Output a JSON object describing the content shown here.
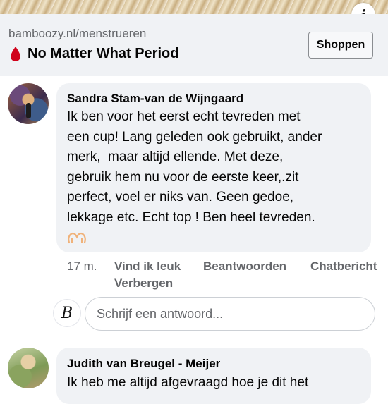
{
  "ad": {
    "url": "bamboozy.nl/menstrueren",
    "title": "No Matter What Period",
    "cta_label": "Shoppen",
    "info_label": "i"
  },
  "comments": [
    {
      "author": "Sandra Stam-van de Wijngaard",
      "lines": [
        "Ik ben voor het eerst echt tevreden met",
        "een cup! Lang geleden ook gebruikt, ander",
        "merk,  maar altijd ellende. Met deze,",
        "gebruik hem nu voor de eerste keer,.zit",
        "perfect, voel er niks van. Geen gedoe,",
        "lekkage etc. Echt top ! Ben heel tevreden."
      ],
      "emoji_icon": "heart-hands-icon",
      "time": "17 m.",
      "like_label": "Vind ik leuk",
      "reply_label": "Beantwoorden",
      "chat_label": "Chatbericht",
      "hide_label": "Verbergen"
    },
    {
      "author": "Judith van Breugel - Meijer",
      "lines": [
        "Ik heb me altijd afgevraagd hoe je dit het"
      ]
    }
  ],
  "reply_box": {
    "placeholder": "Schrijf een antwoord...",
    "page_avatar_glyph": "B"
  },
  "colors": {
    "bubble": "#f0f2f5",
    "meta_text": "#65676b",
    "drop_red": "#d0021b"
  }
}
